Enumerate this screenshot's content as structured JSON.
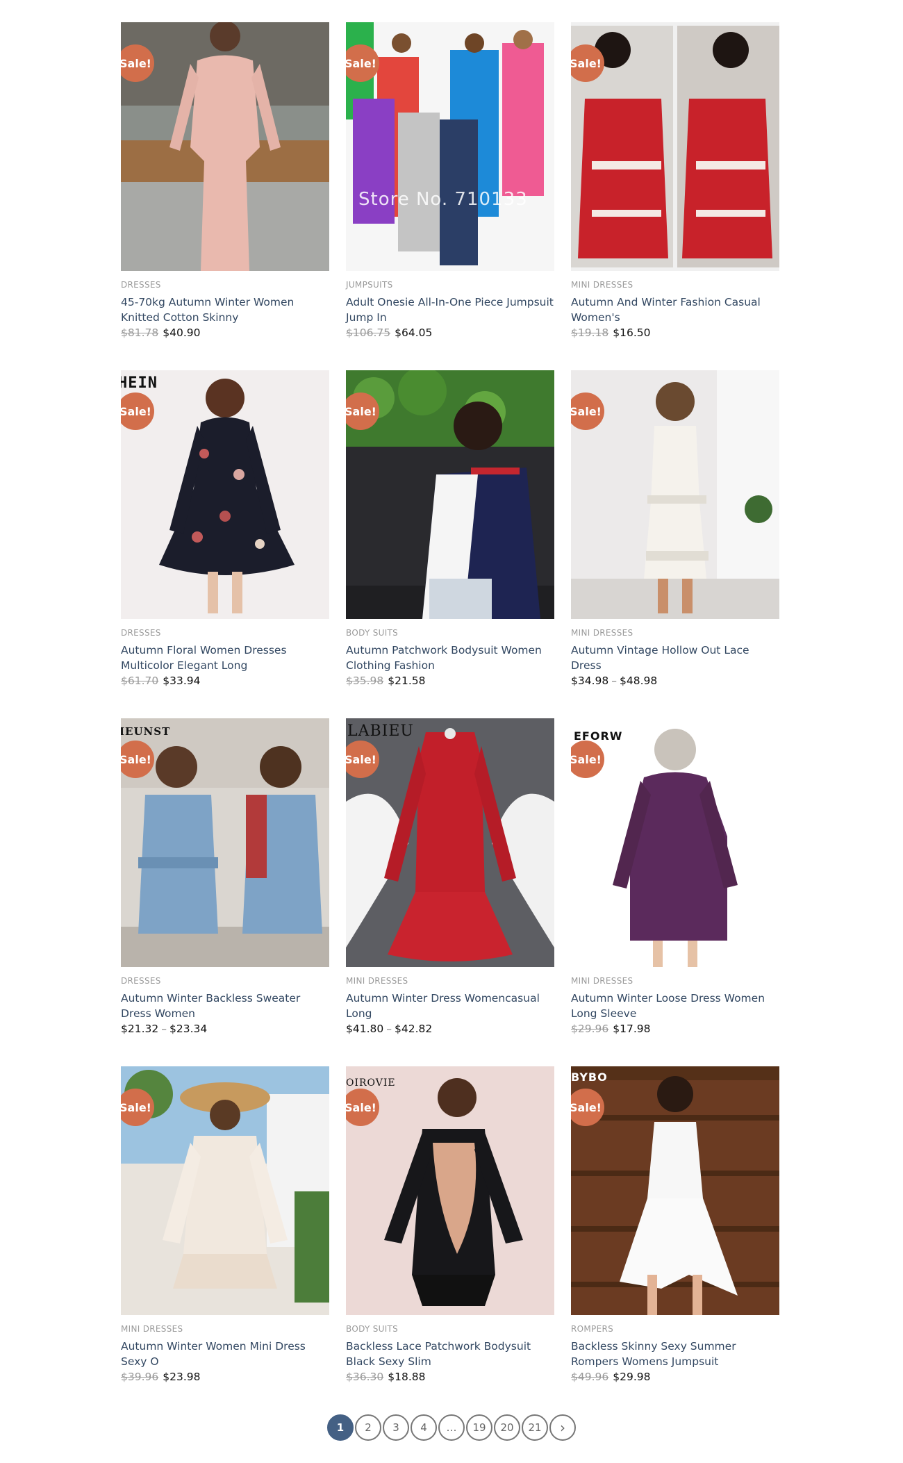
{
  "sale_label": "Sale!",
  "products": [
    {
      "category": "DRESSES",
      "title": "45-70kg Autumn Winter Women Knitted Cotton Skinny",
      "old_price": "$81.78",
      "price": "$40.90",
      "overlay": ""
    },
    {
      "category": "JUMPSUITS",
      "title": "Adult Onesie All-In-One Piece Jumpsuit Jump In",
      "old_price": "$106.75",
      "price": "$64.05",
      "overlay": "Store No. 710133"
    },
    {
      "category": "MINI DRESSES",
      "title": "Autumn And Winter Fashion Casual Women's",
      "old_price": "$19.18",
      "price": "$16.50",
      "overlay": ""
    },
    {
      "category": "DRESSES",
      "title": "Autumn Floral Women Dresses Multicolor Elegant Long",
      "old_price": "$61.70",
      "price": "$33.94",
      "overlay": "HEIN"
    },
    {
      "category": "BODY SUITS",
      "title": "Autumn Patchwork Bodysuit Women Clothing Fashion",
      "old_price": "$35.98",
      "price": "$21.58",
      "overlay": ""
    },
    {
      "category": "MINI DRESSES",
      "title": "Autumn Vintage Hollow Out Lace Dress",
      "price_range": [
        "$34.98",
        "$48.98"
      ],
      "overlay": ""
    },
    {
      "category": "DRESSES",
      "title": "Autumn Winter Backless Sweater Dress Women",
      "price_range": [
        "$21.32",
        "$23.34"
      ],
      "overlay": "IEUNST"
    },
    {
      "category": "MINI DRESSES",
      "title": "Autumn Winter Dress Womencasual Long",
      "price_range": [
        "$41.80",
        "$42.82"
      ],
      "overlay": "LABIEU"
    },
    {
      "category": "MINI DRESSES",
      "title": "Autumn Winter Loose Dress Women Long Sleeve",
      "old_price": "$29.96",
      "price": "$17.98",
      "overlay": "EFORW"
    },
    {
      "category": "MINI DRESSES",
      "title": "Autumn Winter Women Mini Dress Sexy O",
      "old_price": "$39.96",
      "price": "$23.98",
      "overlay": ""
    },
    {
      "category": "BODY SUITS",
      "title": "Backless Lace Patchwork Bodysuit Black Sexy Slim",
      "old_price": "$36.30",
      "price": "$18.88",
      "overlay": "OIROVIE"
    },
    {
      "category": "ROMPERS",
      "title": "Backless Skinny Sexy Summer Rompers Womens Jumpsuit",
      "old_price": "$49.96",
      "price": "$29.98",
      "overlay": "BYBO"
    }
  ],
  "pagination": {
    "pages": [
      "1",
      "2",
      "3",
      "4",
      "…",
      "19",
      "20",
      "21"
    ],
    "current": "1",
    "next_icon": "chevron-right-icon",
    "next_glyph": "›"
  },
  "colors": {
    "sale_badge": "#d26e4b",
    "title_link": "#334862",
    "pager_current": "#446084"
  }
}
